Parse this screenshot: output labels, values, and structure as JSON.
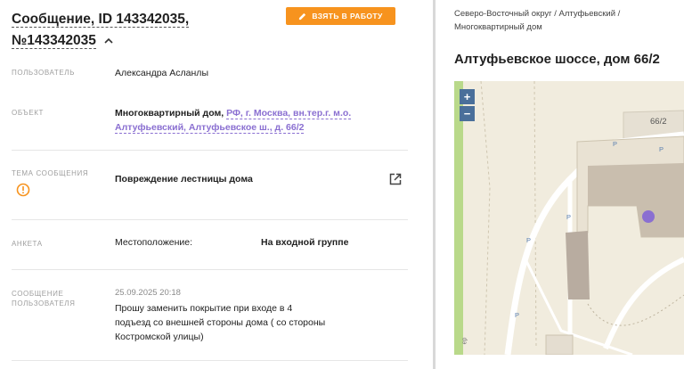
{
  "message": {
    "title_line1": "Сообщение, ID 143342035,",
    "title_line2": "№143342035",
    "take_button": "ВЗЯТЬ В РАБОТУ"
  },
  "fields": {
    "user_label": "ПОЛЬЗОВАТЕЛЬ",
    "user_value": "Александра Асланлы",
    "object_label": "ОБЪЕКТ",
    "object_type": "Многоквартирный дом,",
    "object_link_line1": "РФ, г. Москва, вн.тер.г. м.о.",
    "object_link_line2": "Алтуфьевский, Алтуфьевское ш., д. 66/2",
    "topic_label": "ТЕМА СООБЩЕНИЯ",
    "topic_value": "Повреждение лестницы дома",
    "form_label": "АНКЕТА",
    "form_key": "Местоположение:",
    "form_value": "На входной группе",
    "msg_label_line1": "СООБЩЕНИЕ",
    "msg_label_line2": "ПОЛЬЗОВАТЕЛЯ",
    "msg_date": "25.09.2025 20:18",
    "msg_line1": "Прошу заменить покрытие при входе в 4",
    "msg_line2": "подъезд со внешней стороны дома ( со стороны",
    "msg_line3": "Костромской улицы)"
  },
  "map_panel": {
    "breadcrumb_line1": "Северо-Восточный округ / Алтуфьевский /",
    "breadcrumb_line2": "Многоквартирный дом",
    "address": "Алтуфьевское шоссе, дом 66/2",
    "zoom_in": "+",
    "zoom_out": "−",
    "building_number": "66/2",
    "parking_label": "P",
    "road_fragment": "ер"
  },
  "colors": {
    "accent_orange": "#f7931e",
    "link_purple": "#8a6fd1",
    "marker_purple": "#8a6fd1",
    "warning_orange": "#f7931e"
  },
  "icons": [
    "pencil-icon",
    "chevron-up-icon",
    "warning-icon",
    "external-link-icon"
  ]
}
